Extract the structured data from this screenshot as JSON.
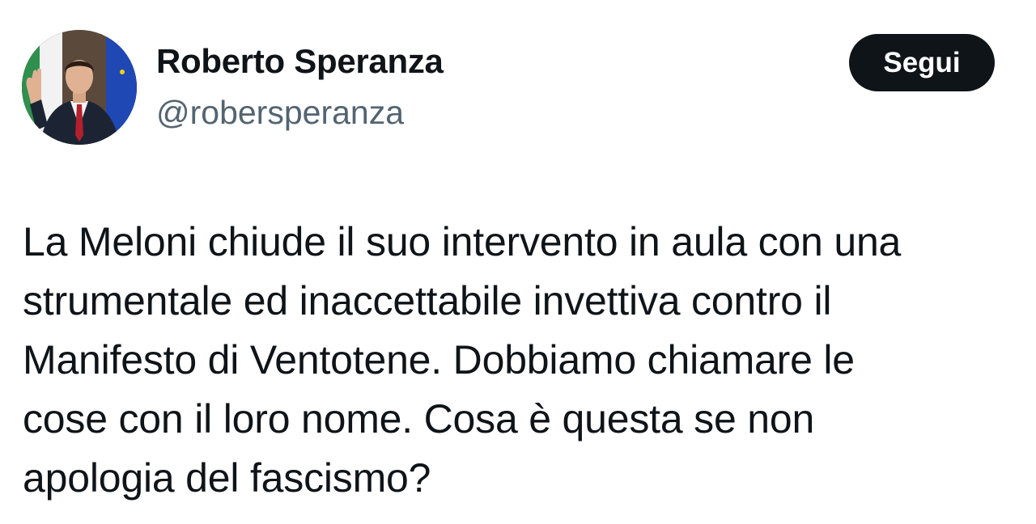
{
  "tweet": {
    "author": {
      "display_name": "Roberto Speranza",
      "handle": "@robersperanza",
      "avatar_icon": "profile-photo"
    },
    "follow_button_label": "Segui",
    "text": "La Meloni chiude il suo intervento in aula con una\nstrumentale ed inaccettabile invettiva contro il\nManifesto di Ventotene. Dobbiamo chiamare le\ncose con il loro nome. Cosa è questa se non\napologia del fascismo?"
  },
  "colors": {
    "text_primary": "#0f1419",
    "text_secondary": "#536471",
    "button_bg": "#0f1419",
    "button_text": "#ffffff",
    "background": "#ffffff"
  }
}
